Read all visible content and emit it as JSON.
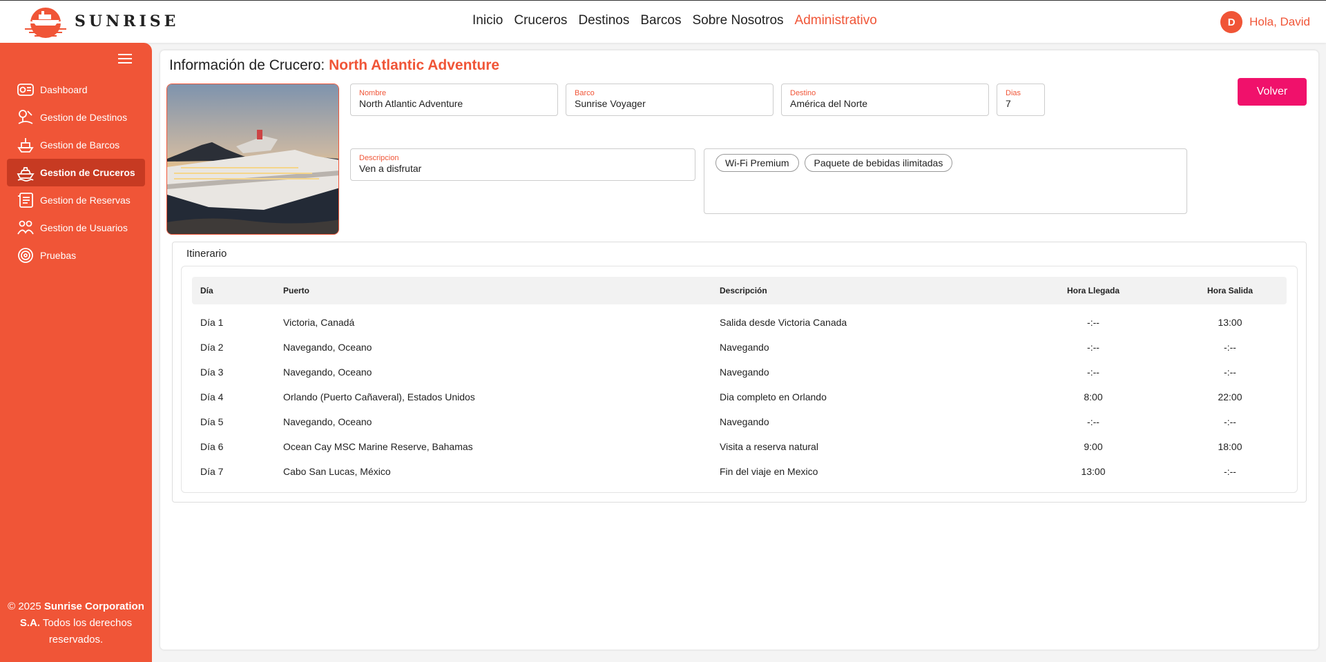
{
  "brand": {
    "name": "SUNRISE"
  },
  "nav": {
    "items": [
      {
        "label": "Inicio",
        "active": false
      },
      {
        "label": "Cruceros",
        "active": false
      },
      {
        "label": "Destinos",
        "active": false
      },
      {
        "label": "Barcos",
        "active": false
      },
      {
        "label": "Sobre Nosotros",
        "active": false
      },
      {
        "label": "Administrativo",
        "active": true
      }
    ]
  },
  "user": {
    "initial": "D",
    "greeting": "Hola, David"
  },
  "sidebar": {
    "items": [
      {
        "label": "Dashboard",
        "icon": "dashboard-icon"
      },
      {
        "label": "Gestion de Destinos",
        "icon": "map-pin-icon"
      },
      {
        "label": "Gestion de Barcos",
        "icon": "ship-icon"
      },
      {
        "label": "Gestion de Cruceros",
        "icon": "cruise-icon",
        "active": true
      },
      {
        "label": "Gestion de Reservas",
        "icon": "reservations-icon"
      },
      {
        "label": "Gestion de Usuarios",
        "icon": "users-icon"
      },
      {
        "label": "Pruebas",
        "icon": "target-icon"
      }
    ],
    "footer": {
      "prefix": "© 2025 ",
      "company": "Sunrise Corporation S.A.",
      "suffix": " Todos los derechos reservados."
    }
  },
  "page": {
    "title_prefix": "Información de Crucero: ",
    "title_name": "North Atlantic Adventure",
    "back_button": "Volver",
    "fields": {
      "nombre": {
        "label": "Nombre",
        "value": "North Atlantic Adventure"
      },
      "barco": {
        "label": "Barco",
        "value": "Sunrise Voyager"
      },
      "destino": {
        "label": "Destino",
        "value": "América del Norte"
      },
      "dias": {
        "label": "Dias",
        "value": "7"
      },
      "descripcion": {
        "label": "Descripcion",
        "value": "Ven a disfrutar"
      }
    },
    "services": [
      "Wi-Fi Premium",
      "Paquete de bebidas ilimitadas"
    ]
  },
  "itinerary": {
    "title": "Itinerario",
    "headers": {
      "dia": "Día",
      "puerto": "Puerto",
      "descripcion": "Descripción",
      "llegada": "Hora Llegada",
      "salida": "Hora Salida"
    },
    "rows": [
      {
        "dia": "Día 1",
        "puerto": "Victoria, Canadá",
        "descripcion": "Salida desde Victoria Canada",
        "llegada": "-:--",
        "salida": "13:00"
      },
      {
        "dia": "Día 2",
        "puerto": "Navegando, Oceano",
        "descripcion": "Navegando",
        "llegada": "-:--",
        "salida": "-:--"
      },
      {
        "dia": "Día 3",
        "puerto": "Navegando, Oceano",
        "descripcion": "Navegando",
        "llegada": "-:--",
        "salida": "-:--"
      },
      {
        "dia": "Día 4",
        "puerto": "Orlando (Puerto Cañaveral), Estados Unidos",
        "descripcion": "Dia completo en Orlando",
        "llegada": "8:00",
        "salida": "22:00"
      },
      {
        "dia": "Día 5",
        "puerto": "Navegando, Oceano",
        "descripcion": "Navegando",
        "llegada": "-:--",
        "salida": "-:--"
      },
      {
        "dia": "Día 6",
        "puerto": "Ocean Cay MSC Marine Reserve, Bahamas",
        "descripcion": "Visita a reserva natural",
        "llegada": "9:00",
        "salida": "18:00"
      },
      {
        "dia": "Día 7",
        "puerto": "Cabo San Lucas, México",
        "descripcion": "Fin del viaje en Mexico",
        "llegada": "13:00",
        "salida": "-:--"
      }
    ]
  }
}
